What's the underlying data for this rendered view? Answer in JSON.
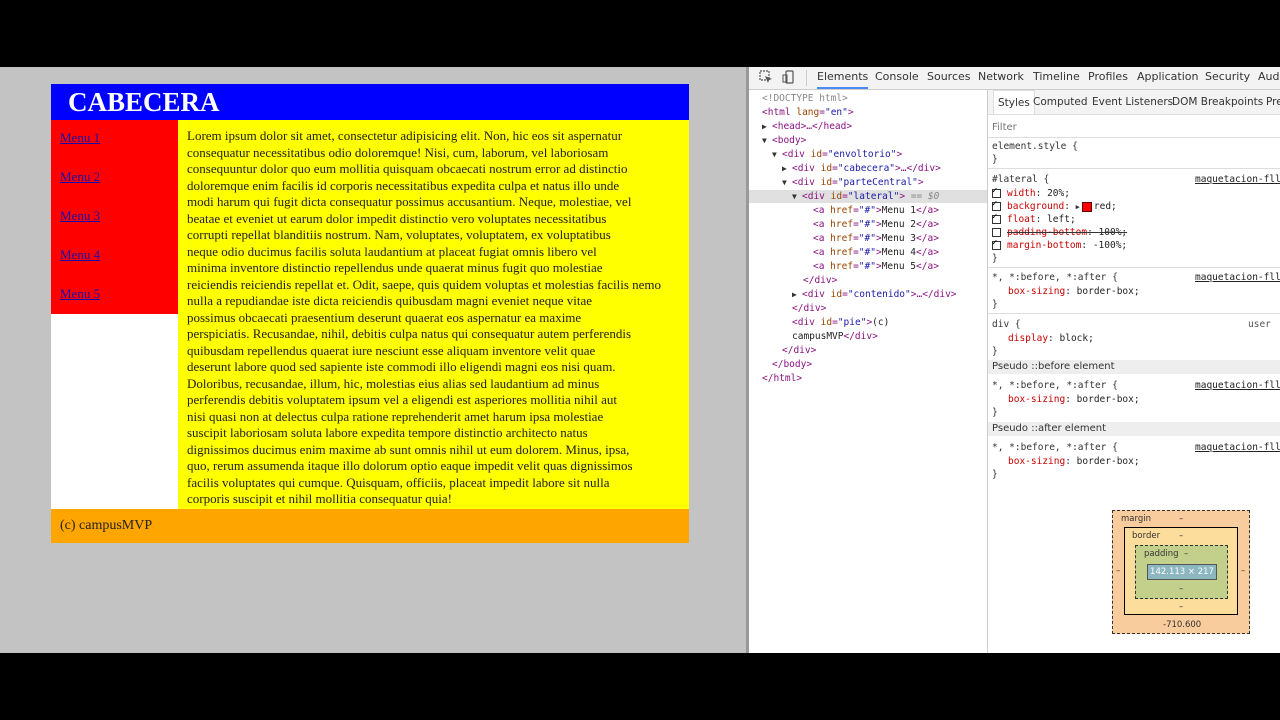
{
  "page": {
    "header": "CABECERA",
    "menu": [
      "Menu 1",
      "Menu 2",
      "Menu 3",
      "Menu 4",
      "Menu 5"
    ],
    "content_lines": [
      "Lorem ipsum dolor sit amet, consectetur adipisicing elit. Non, hic eos sit aspernatur",
      "consequatur necessitatibus odio doloremque! Nisi, cum, laborum, vel laboriosam",
      "consequuntur dolor quo eum mollitia quisquam obcaecati nostrum error ad distinctio",
      "doloremque enim facilis id corporis necessitatibus expedita culpa et natus illo unde",
      "modi harum qui fugit dicta consequatur possimus accusantium. Neque, molestiae, vel",
      "beatae et eveniet ut earum dolor impedit distinctio vero voluptates necessitatibus",
      "corrupti repellat blanditiis nostrum. Nam, voluptates, voluptatem, ex voluptatibus",
      "neque odio ducimus facilis soluta laudantium at placeat fugiat omnis libero vel",
      "minima inventore distinctio repellendus unde quaerat minus fugit quo molestiae",
      "reiciendis reiciendis repellat et. Odit, saepe, quis quidem voluptas et molestias facilis nemo",
      "nulla a repudiandae iste dicta reiciendis quibusdam magni eveniet neque vitae",
      "possimus obcaecati praesentium deserunt quaerat eos aspernatur ea maxime",
      "perspiciatis. Recusandae, nihil, debitis culpa natus qui consequatur autem perferendis",
      "quibusdam repellendus quaerat iure nesciunt esse aliquam inventore velit quae",
      "deserunt labore quod sed sapiente iste commodi illo eligendi magni eos nisi quam.",
      "Doloribus, recusandae, illum, hic, molestias eius alias sed laudantium ad minus",
      "perferendis debitis voluptatem ipsum vel a eligendi est asperiores mollitia nihil aut",
      "nisi quasi non at delectus culpa ratione reprehenderit amet harum ipsa molestiae",
      "suscipit laboriosam soluta labore expedita tempore distinctio architecto natus",
      "dignissimos ducimus enim maxime ab sunt omnis nihil ut eum dolorem. Minus, ipsa,",
      "quo, rerum assumenda itaque illo dolorum optio eaque impedit velit quas dignissimos",
      "facilis voluptates qui cumque. Quisquam, officiis, placeat impedit labore sit nulla",
      "corporis suscipit et nihil mollitia consequatur quia!"
    ],
    "footer": "(c) campusMVP"
  },
  "devtools": {
    "tabs": [
      "Elements",
      "Console",
      "Sources",
      "Network",
      "Timeline",
      "Profiles",
      "Application",
      "Security",
      "Audi"
    ],
    "active_tab": "Elements",
    "dom": {
      "doctype": "<!DOCTYPE html>",
      "html_open": [
        "html",
        "lang",
        "\"en\""
      ],
      "head": "<head>…</head>",
      "body_open": "<body>",
      "envoltorio": [
        "div",
        "id",
        "\"envoltorio\""
      ],
      "cabecera": [
        "div",
        "id",
        "\"cabecera\"",
        "…</div>"
      ],
      "parteCentral": [
        "div",
        "id",
        "\"parteCentral\""
      ],
      "lateral": [
        "div",
        "id",
        "\"lateral\"",
        "== $0"
      ],
      "links": [
        {
          "attr": "href",
          "val": "\"#\"",
          "text": "Menu 1"
        },
        {
          "attr": "href",
          "val": "\"#\"",
          "text": "Menu 2"
        },
        {
          "attr": "href",
          "val": "\"#\"",
          "text": "Menu 3"
        },
        {
          "attr": "href",
          "val": "\"#\"",
          "text": "Menu 4"
        },
        {
          "attr": "href",
          "val": "\"#\"",
          "text": "Menu 5"
        }
      ],
      "div_close": "</div>",
      "contenido": [
        "div",
        "id",
        "\"contenido\"",
        "…</div>"
      ],
      "pie": [
        "div",
        "id",
        "\"pie\"",
        "(c)"
      ],
      "pie_text": "campusMVP",
      "body_close": "</body>",
      "html_close": "</html>"
    },
    "styles": {
      "tabs": [
        "Styles",
        "Computed",
        "Event Listeners",
        "DOM Breakpoints",
        "Pre"
      ],
      "filter_placeholder": "Filter",
      "element_style": "element.style {",
      "close_brace": "}",
      "rule1": {
        "selector": "#lateral {",
        "source": "maquetacion-fll",
        "props": [
          {
            "name": "width",
            "value": "20%;",
            "checked": true,
            "struck": false
          },
          {
            "name": "background",
            "value": "red;",
            "checked": true,
            "struck": false,
            "swatch": "#ff0000"
          },
          {
            "name": "float",
            "value": "left;",
            "checked": true,
            "struck": false
          },
          {
            "name": "padding-bottom",
            "value": "100%;",
            "checked": false,
            "struck": true
          },
          {
            "name": "margin-bottom",
            "value": "-100%;",
            "checked": true,
            "struck": false
          }
        ]
      },
      "rule2": {
        "selector": "*, *:before, *:after {",
        "source": "maquetacion-fll",
        "prop": "box-sizing",
        "value": "border-box;"
      },
      "rule3": {
        "selector": "div {",
        "source": "user",
        "prop": "display",
        "value": "block;"
      },
      "pseudo_before": "Pseudo ::before element",
      "rule4": {
        "selector": "*, *:before, *:after {",
        "source": "maquetacion-fll",
        "prop": "box-sizing",
        "value": "border-box;"
      },
      "pseudo_after": "Pseudo ::after element",
      "rule5": {
        "selector": "*, *:before, *:after {",
        "source": "maquetacion-fll",
        "prop": "box-sizing",
        "value": "border-box;"
      }
    },
    "box_model": {
      "margin_label": "margin",
      "border_label": "border",
      "padding_label": "padding",
      "dash": "–",
      "content_size": "142.113 × 217",
      "margin_bottom": "-710.600"
    }
  }
}
